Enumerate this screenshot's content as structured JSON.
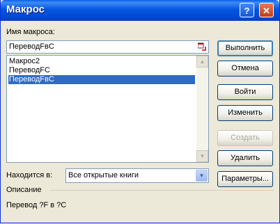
{
  "window": {
    "title": "Макрос",
    "help_label": "?",
    "close_label": "✕"
  },
  "macro_name": {
    "label": "Имя макроса:",
    "value": "ПереводFвC"
  },
  "macro_list": {
    "items": [
      {
        "label": "Макрос2",
        "selected": false
      },
      {
        "label": "ПереводFC",
        "selected": false
      },
      {
        "label": "ПереводFвC",
        "selected": true
      }
    ]
  },
  "location": {
    "label": "Находится в:",
    "value": "Все открытые книги"
  },
  "description": {
    "label": "Описание",
    "text": "Перевод ?F в ?C"
  },
  "buttons": {
    "run": "Выполнить",
    "cancel": "Отмена",
    "step_into": "Войти",
    "edit": "Изменить",
    "create": "Создать",
    "delete": "Удалить",
    "options": "Параметры..."
  },
  "colors": {
    "title_bar": "#0a5fe8",
    "selection": "#316ac5",
    "dialog_bg": "#ece9d8"
  }
}
